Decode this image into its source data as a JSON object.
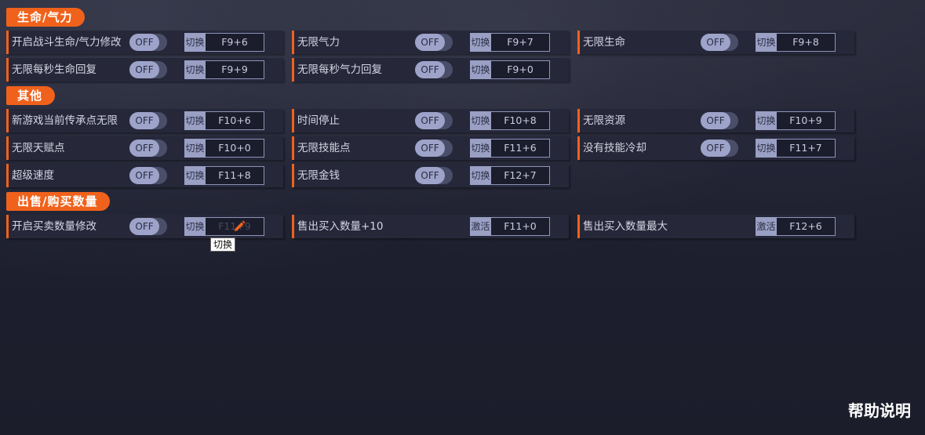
{
  "sections": [
    {
      "title": "生命/气力",
      "items": [
        {
          "label": "开启战斗生命/气力修改",
          "toggle": "OFF",
          "mode": "切换",
          "key": "F9+6"
        },
        {
          "label": "无限气力",
          "toggle": "OFF",
          "mode": "切换",
          "key": "F9+7"
        },
        {
          "label": "无限生命",
          "toggle": "OFF",
          "mode": "切换",
          "key": "F9+8"
        },
        {
          "label": "无限每秒生命回复",
          "toggle": "OFF",
          "mode": "切换",
          "key": "F9+9"
        },
        {
          "label": "无限每秒气力回复",
          "toggle": "OFF",
          "mode": "切换",
          "key": "F9+0"
        }
      ]
    },
    {
      "title": "其他",
      "items": [
        {
          "label": "新游戏当前传承点无限",
          "toggle": "OFF",
          "mode": "切换",
          "key": "F10+6"
        },
        {
          "label": "时间停止",
          "toggle": "OFF",
          "mode": "切换",
          "key": "F10+8"
        },
        {
          "label": "无限资源",
          "toggle": "OFF",
          "mode": "切换",
          "key": "F10+9"
        },
        {
          "label": "无限天赋点",
          "toggle": "OFF",
          "mode": "切换",
          "key": "F10+0"
        },
        {
          "label": "无限技能点",
          "toggle": "OFF",
          "mode": "切换",
          "key": "F11+6"
        },
        {
          "label": "没有技能冷却",
          "toggle": "OFF",
          "mode": "切换",
          "key": "F11+7"
        },
        {
          "label": "超级速度",
          "toggle": "OFF",
          "mode": "切换",
          "key": "F11+8"
        },
        {
          "label": "无限金钱",
          "toggle": "OFF",
          "mode": "切换",
          "key": "F12+7"
        }
      ]
    },
    {
      "title": "出售/购买数量",
      "items": [
        {
          "label": "开启买卖数量修改",
          "toggle": "OFF",
          "mode": "切换",
          "key": "F11+9"
        },
        {
          "label": "售出买入数量+10",
          "mode": "激活",
          "key": "F11+0"
        },
        {
          "label": "售出买入数量最大",
          "mode": "激活",
          "key": "F12+6"
        }
      ]
    }
  ],
  "tooltip": "切换",
  "help_label": "帮助说明",
  "colors": {
    "accent": "#f0621c",
    "background": "#1d1f2e",
    "cell": "#26283a",
    "toggle_knob": "#9da3c9"
  },
  "icons": {
    "edit": "pencil-icon"
  }
}
